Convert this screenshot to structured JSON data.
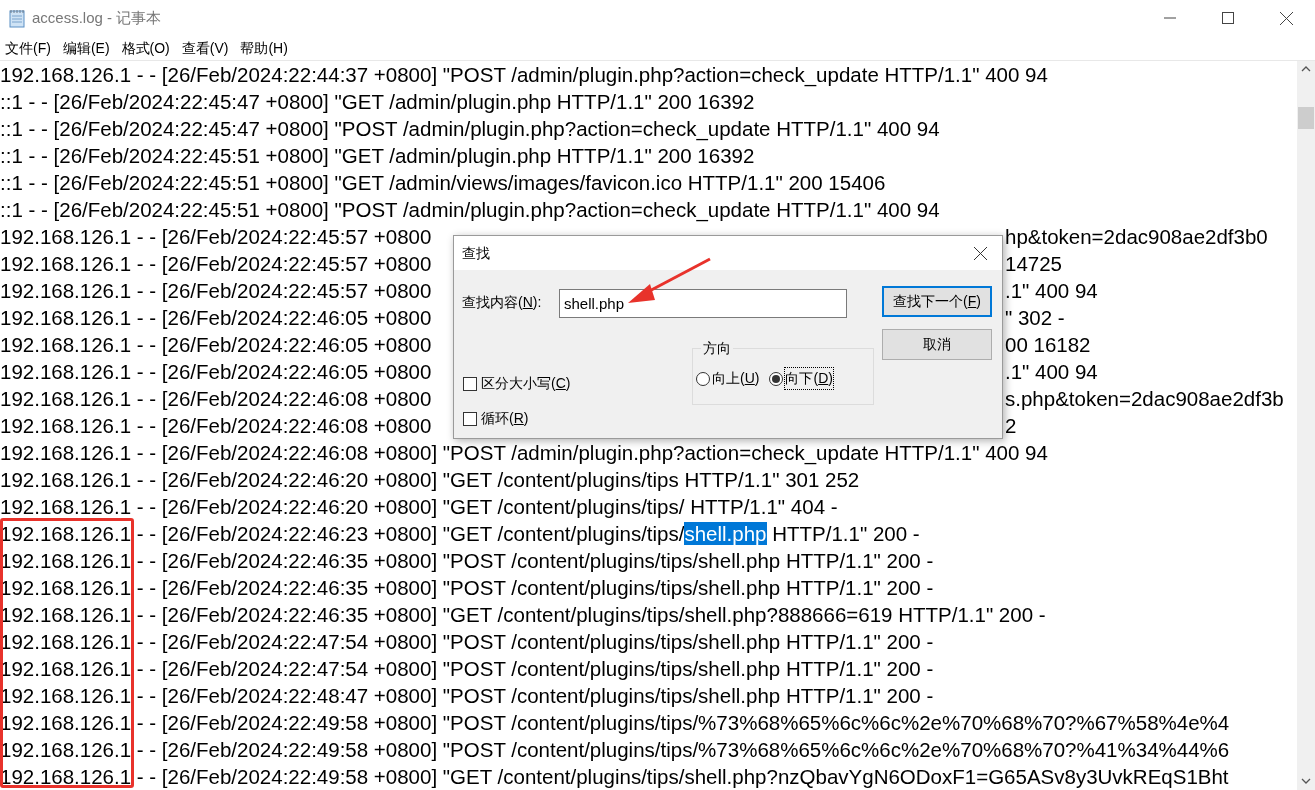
{
  "window": {
    "title": "access.log - 记事本"
  },
  "menu": [
    {
      "label": "文件(F)"
    },
    {
      "label": "编辑(E)"
    },
    {
      "label": "格式(O)"
    },
    {
      "label": "查看(V)"
    },
    {
      "label": "帮助(H)"
    }
  ],
  "lines": [
    {
      "kind": "plain",
      "text": "192.168.126.1 - - [26/Feb/2024:22:44:37 +0800] \"POST /admin/plugin.php?action=check_update HTTP/1.1\" 400 94"
    },
    {
      "kind": "plain",
      "text": "::1 - - [26/Feb/2024:22:45:47 +0800] \"GET /admin/plugin.php HTTP/1.1\" 200 16392"
    },
    {
      "kind": "plain",
      "text": "::1 - - [26/Feb/2024:22:45:47 +0800] \"POST /admin/plugin.php?action=check_update HTTP/1.1\" 400 94"
    },
    {
      "kind": "plain",
      "text": "::1 - - [26/Feb/2024:22:45:51 +0800] \"GET /admin/plugin.php HTTP/1.1\" 200 16392"
    },
    {
      "kind": "plain",
      "text": "::1 - - [26/Feb/2024:22:45:51 +0800] \"GET /admin/views/images/favicon.ico HTTP/1.1\" 200 15406"
    },
    {
      "kind": "plain",
      "text": "::1 - - [26/Feb/2024:22:45:51 +0800] \"POST /admin/plugin.php?action=check_update HTTP/1.1\" 400 94"
    },
    {
      "kind": "split",
      "text": "192.168.126.1 - - [26/Feb/2024:22:45:57 +0800",
      "tail": "hp&token=2dac908ae2df3b0"
    },
    {
      "kind": "split",
      "text": "192.168.126.1 - - [26/Feb/2024:22:45:57 +0800",
      "tail": "14725"
    },
    {
      "kind": "split",
      "text": "192.168.126.1 - - [26/Feb/2024:22:45:57 +0800",
      "tail": ".1\" 400 94"
    },
    {
      "kind": "split",
      "text": "192.168.126.1 - - [26/Feb/2024:22:46:05 +0800",
      "tail": "\" 302 -"
    },
    {
      "kind": "split",
      "text": "192.168.126.1 - - [26/Feb/2024:22:46:05 +0800",
      "tail": "00 16182"
    },
    {
      "kind": "split",
      "text": "192.168.126.1 - - [26/Feb/2024:22:46:05 +0800",
      "tail": ".1\" 400 94"
    },
    {
      "kind": "split",
      "text": "192.168.126.1 - - [26/Feb/2024:22:46:08 +0800",
      "tail": "s.php&token=2dac908ae2df3b"
    },
    {
      "kind": "split",
      "text": "192.168.126.1 - - [26/Feb/2024:22:46:08 +0800",
      "tail": "2"
    },
    {
      "kind": "plain",
      "text": "192.168.126.1 - - [26/Feb/2024:22:46:08 +0800] \"POST /admin/plugin.php?action=check_update HTTP/1.1\" 400 94"
    },
    {
      "kind": "plain",
      "text": "192.168.126.1 - - [26/Feb/2024:22:46:20 +0800] \"GET /content/plugins/tips HTTP/1.1\" 301 252"
    },
    {
      "kind": "plain",
      "text": "192.168.126.1 - - [26/Feb/2024:22:46:20 +0800] \"GET /content/plugins/tips/ HTTP/1.1\" 404 -"
    },
    {
      "kind": "segments",
      "segments": [
        {
          "text": "192.168.126.1 - - [26/Feb/2024:22:46:23 +0800] \"GET /content/plugins/tips/",
          "selected": false
        },
        {
          "text": "shell.php",
          "selected": true
        },
        {
          "text": " HTTP/1.1\" 200 -",
          "selected": false
        }
      ]
    },
    {
      "kind": "plain",
      "text": "192.168.126.1 - - [26/Feb/2024:22:46:35 +0800] \"POST /content/plugins/tips/shell.php HTTP/1.1\" 200 -"
    },
    {
      "kind": "plain",
      "text": "192.168.126.1 - - [26/Feb/2024:22:46:35 +0800] \"POST /content/plugins/tips/shell.php HTTP/1.1\" 200 -"
    },
    {
      "kind": "plain",
      "text": "192.168.126.1 - - [26/Feb/2024:22:46:35 +0800] \"GET /content/plugins/tips/shell.php?888666=619 HTTP/1.1\" 200 -"
    },
    {
      "kind": "plain",
      "text": "192.168.126.1 - - [26/Feb/2024:22:47:54 +0800] \"POST /content/plugins/tips/shell.php HTTP/1.1\" 200 -"
    },
    {
      "kind": "plain",
      "text": "192.168.126.1 - - [26/Feb/2024:22:47:54 +0800] \"POST /content/plugins/tips/shell.php HTTP/1.1\" 200 -"
    },
    {
      "kind": "plain",
      "text": "192.168.126.1 - - [26/Feb/2024:22:48:47 +0800] \"POST /content/plugins/tips/shell.php HTTP/1.1\" 200 -"
    },
    {
      "kind": "plain",
      "text": "192.168.126.1 - - [26/Feb/2024:22:49:58 +0800] \"POST /content/plugins/tips/%73%68%65%6c%6c%2e%70%68%70?%67%58%4e%4"
    },
    {
      "kind": "plain",
      "text": "192.168.126.1 - - [26/Feb/2024:22:49:58 +0800] \"POST /content/plugins/tips/%73%68%65%6c%6c%2e%70%68%70?%41%34%44%6"
    },
    {
      "kind": "plain",
      "text": "192.168.126.1 - - [26/Feb/2024:22:49:58 +0800] \"GET /content/plugins/tips/shell.php?nzQbavYgN6ODoxF1=G65ASv8y3UvkREqS1Bht"
    }
  ],
  "find_dialog": {
    "title": "查找",
    "field_label": "查找内容(N):",
    "value": "shell.php",
    "buttons": [
      {
        "label": "查找下一个(F)",
        "default": true
      },
      {
        "label": "取消",
        "default": false
      }
    ],
    "direction_group": "方向",
    "radios": [
      {
        "label": "向上(U)",
        "selected": false
      },
      {
        "label": "向下(D)",
        "selected": true
      }
    ],
    "checkboxes": [
      {
        "label": "区分大小写(C)",
        "checked": false
      },
      {
        "label": "循环(R)",
        "checked": false
      }
    ]
  },
  "annotations": {
    "frame": true,
    "arrow": true
  }
}
